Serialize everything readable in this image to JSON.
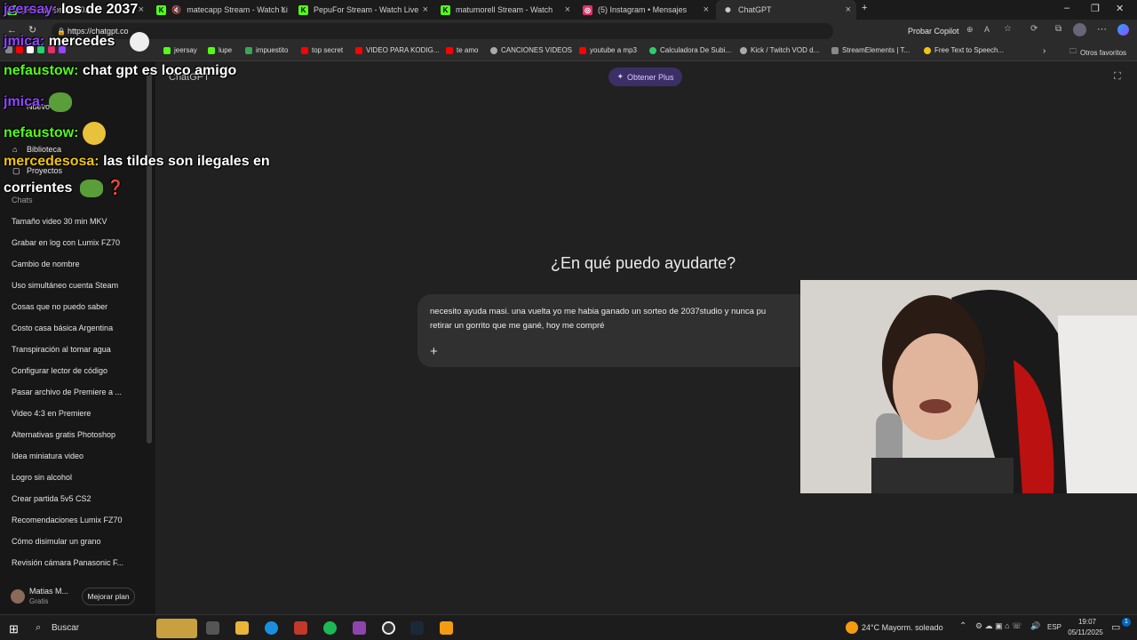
{
  "colors": {
    "accent_plus": "#3b2f66",
    "sidebar_bg": "#171717",
    "main_bg": "#212121"
  },
  "tabs": [
    {
      "label": "jeersay: los de 2037",
      "icon": "kick-icon",
      "color": "#53fc18"
    },
    {
      "label": "matecapp Stream - Watch Li",
      "icon": "mute-icon",
      "color": "#53fc18"
    },
    {
      "label": "PepuFor Stream - Watch Live",
      "icon": "kick-icon",
      "color": "#53fc18"
    },
    {
      "label": "matumorell Stream - Watch",
      "icon": "kick-icon",
      "color": "#53fc18"
    },
    {
      "label": "(5) Instagram • Mensajes",
      "icon": "instagram-icon",
      "color": "#e1306c"
    },
    {
      "label": "ChatGPT",
      "icon": "chatgpt-icon",
      "color": "#cccccc"
    }
  ],
  "address": {
    "url": "https://chatgpt.co",
    "copilot": "Probar Copilot"
  },
  "bookmarks": [
    {
      "label": "jeersay",
      "color": "#53fc18"
    },
    {
      "label": "lupe",
      "color": "#53fc18"
    },
    {
      "label": "impuestito",
      "color": "#3aa655"
    },
    {
      "label": "top secret",
      "color": "#ff0000"
    },
    {
      "label": "VIDEO PARA KODIG...",
      "color": "#ff0000"
    },
    {
      "label": "te amo",
      "color": "#ff0000"
    },
    {
      "label": "CANCIONES VIDEOS",
      "color": "#aaaaaa"
    },
    {
      "label": "youtube a mp3",
      "color": "#ff0000"
    },
    {
      "label": "Calculadora De Subi...",
      "color": "#2ecc71"
    },
    {
      "label": "Kick / Twitch VOD d...",
      "color": "#aaaaaa"
    },
    {
      "label": "StreamElements | T...",
      "color": "#888888"
    },
    {
      "label": "Free Text to Speech...",
      "color": "#f1c40f"
    }
  ],
  "bookmarks_other": "Otros favoritos",
  "sidebar": {
    "brand": "ChatGPT",
    "new_chat": "Nuevo",
    "library": "Biblioteca",
    "projects": "Proyectos",
    "section": "Chats",
    "chats": [
      "Tamaño video 30 min MKV",
      "Grabar en log con Lumix FZ70",
      "Cambio de nombre",
      "Uso simultáneo cuenta Steam",
      "Cosas que no puedo saber",
      "Costo casa básica Argentina",
      "Transpiración al tomar agua",
      "Configurar lector de código",
      "Pasar archivo de Premiere a ...",
      "Video 4:3 en Premiere",
      "Alternativas gratis Photoshop",
      "Idea miniatura video",
      "Logro sin alcohol",
      "Crear partida 5v5 CS2",
      "Recomendaciones Lumix FZ70",
      "Cómo disimular un grano",
      "Revisión cámara Panasonic F..."
    ],
    "user_name": "Matias M...",
    "user_plan": "Gratis",
    "upgrade": "Mejorar plan"
  },
  "main": {
    "get_plus": "Obtener Plus",
    "heading": "¿En qué puedo ayudarte?",
    "composer_line1": "necesito ayuda masi. una vuelta yo me habia ganado un sorteo de 2037studio y nunca pu",
    "composer_line2": "retirar un gorrito que me gané, hoy me compré"
  },
  "chat_overlay": [
    {
      "user": "jeersay:",
      "msg": " los de 2037",
      "user_color": "#9147ff"
    },
    {
      "user": "jmica:",
      "msg": " mercedes",
      "user_color": "#9147ff"
    },
    {
      "user": "nefaustow:",
      "msg": " chat gpt es loco amigo",
      "user_color": "#53fc18"
    },
    {
      "user": "jmica:",
      "msg": "",
      "user_color": "#9147ff"
    },
    {
      "user": "nefaustow:",
      "msg": "",
      "user_color": "#53fc18"
    },
    {
      "user": "mercedesosa:",
      "msg": " las tildes son ilegales en",
      "user_color": "#f1c40f"
    },
    {
      "user": "",
      "msg": "corrientes",
      "user_color": "#ffffff"
    }
  ],
  "taskbar": {
    "search": "Buscar",
    "weather": "24°C  Mayorm. soleado",
    "lang": "ESP",
    "time": "19:07",
    "date": "05/11/2025",
    "notif_badge": "1"
  }
}
